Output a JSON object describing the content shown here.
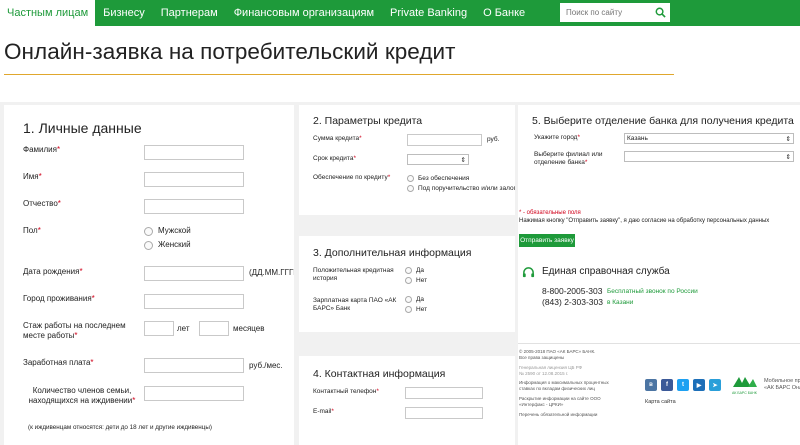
{
  "nav": {
    "items": [
      "Частным лицам",
      "Бизнесу",
      "Партнерам",
      "Финансовым организациям",
      "Private Banking",
      "О Банке"
    ],
    "search_placeholder": "Поиск по сайту"
  },
  "page_title": "Онлайн-заявка на потребительский кредит",
  "personal": {
    "title": "1. Личные данные",
    "surname": "Фамилия",
    "name": "Имя",
    "patronymic": "Отчество",
    "gender": "Пол",
    "male": "Мужской",
    "female": "Женский",
    "birthdate": "Дата рождения",
    "date_format": "(ДД.ММ.ГГГГ)",
    "city": "Город проживания",
    "experience": "Стаж работы на последнем месте работы",
    "years": "лет",
    "months": "месяцев",
    "salary": "Заработная плата",
    "salary_unit": "руб./мес.",
    "family": "Количество членов семьи, находящихся на иждивении",
    "family_note": "(к иждивенцам относятся: дети до 18 лет и другие иждивенцы)"
  },
  "credit": {
    "title": "2. Параметры кредита",
    "amount": "Сумма кредита",
    "amount_unit": "руб.",
    "term": "Срок кредита",
    "security": "Обеспечение по кредиту",
    "no_security": "Без обеспечения",
    "guarantee": "Под поручительство и/или залог"
  },
  "extra": {
    "title": "3. Дополнительная информация",
    "history": "Положительная кредитная история",
    "card": "Зарплатная карта ПАО «АК БАРС» Банк",
    "yes": "Да",
    "no": "Нет"
  },
  "contact": {
    "title": "4. Контактная информация",
    "phone": "Контактный телефон",
    "email": "E-mail"
  },
  "branch": {
    "title": "5. Выберите отделение банка для получения кредита",
    "city_label": "Укажите город",
    "city_value": "Казань",
    "branch_label": "Выберите филиал или отделение банка"
  },
  "submit": {
    "required_note": "- обязательные поля",
    "consent": "Нажимая кнопку \"Отправить заявку\", я даю согласие на обработку персональных данных",
    "button": "Отправить заявку"
  },
  "service": {
    "title": "Единая справочная служба",
    "phone1": "8-800-2005-303",
    "phone1_note": "Бесплатный звонок по России",
    "phone2": "(843) 2-303-303",
    "phone2_note": "в Казани"
  },
  "footer": {
    "copyright": "© 2005-2018 ПАО «АК БАРС» БАНК.",
    "rights": "Все права защищены",
    "license1": "Генеральная лицензия ЦБ РФ",
    "license2": "№ 2590 от 12.08.2015 г.",
    "info1": "Информация о максимальных процентных",
    "info2": "ставках по вкладам физических лиц",
    "disclosure1": "Раскрытие информации на сайте ООО",
    "disclosure2": "«Интерфакс - ЦРКИ»",
    "insiders": "Перечень обязательной информации",
    "sitemap": "Карта сайта",
    "mobile1": "Мобильное прил",
    "mobile2": "«АК БАРС Онл",
    "logo_text": "АК БАРС БАНК"
  },
  "colors": {
    "brand_green": "#1e9a3a",
    "accent": "#e0a72d",
    "required": "#d0021b"
  }
}
